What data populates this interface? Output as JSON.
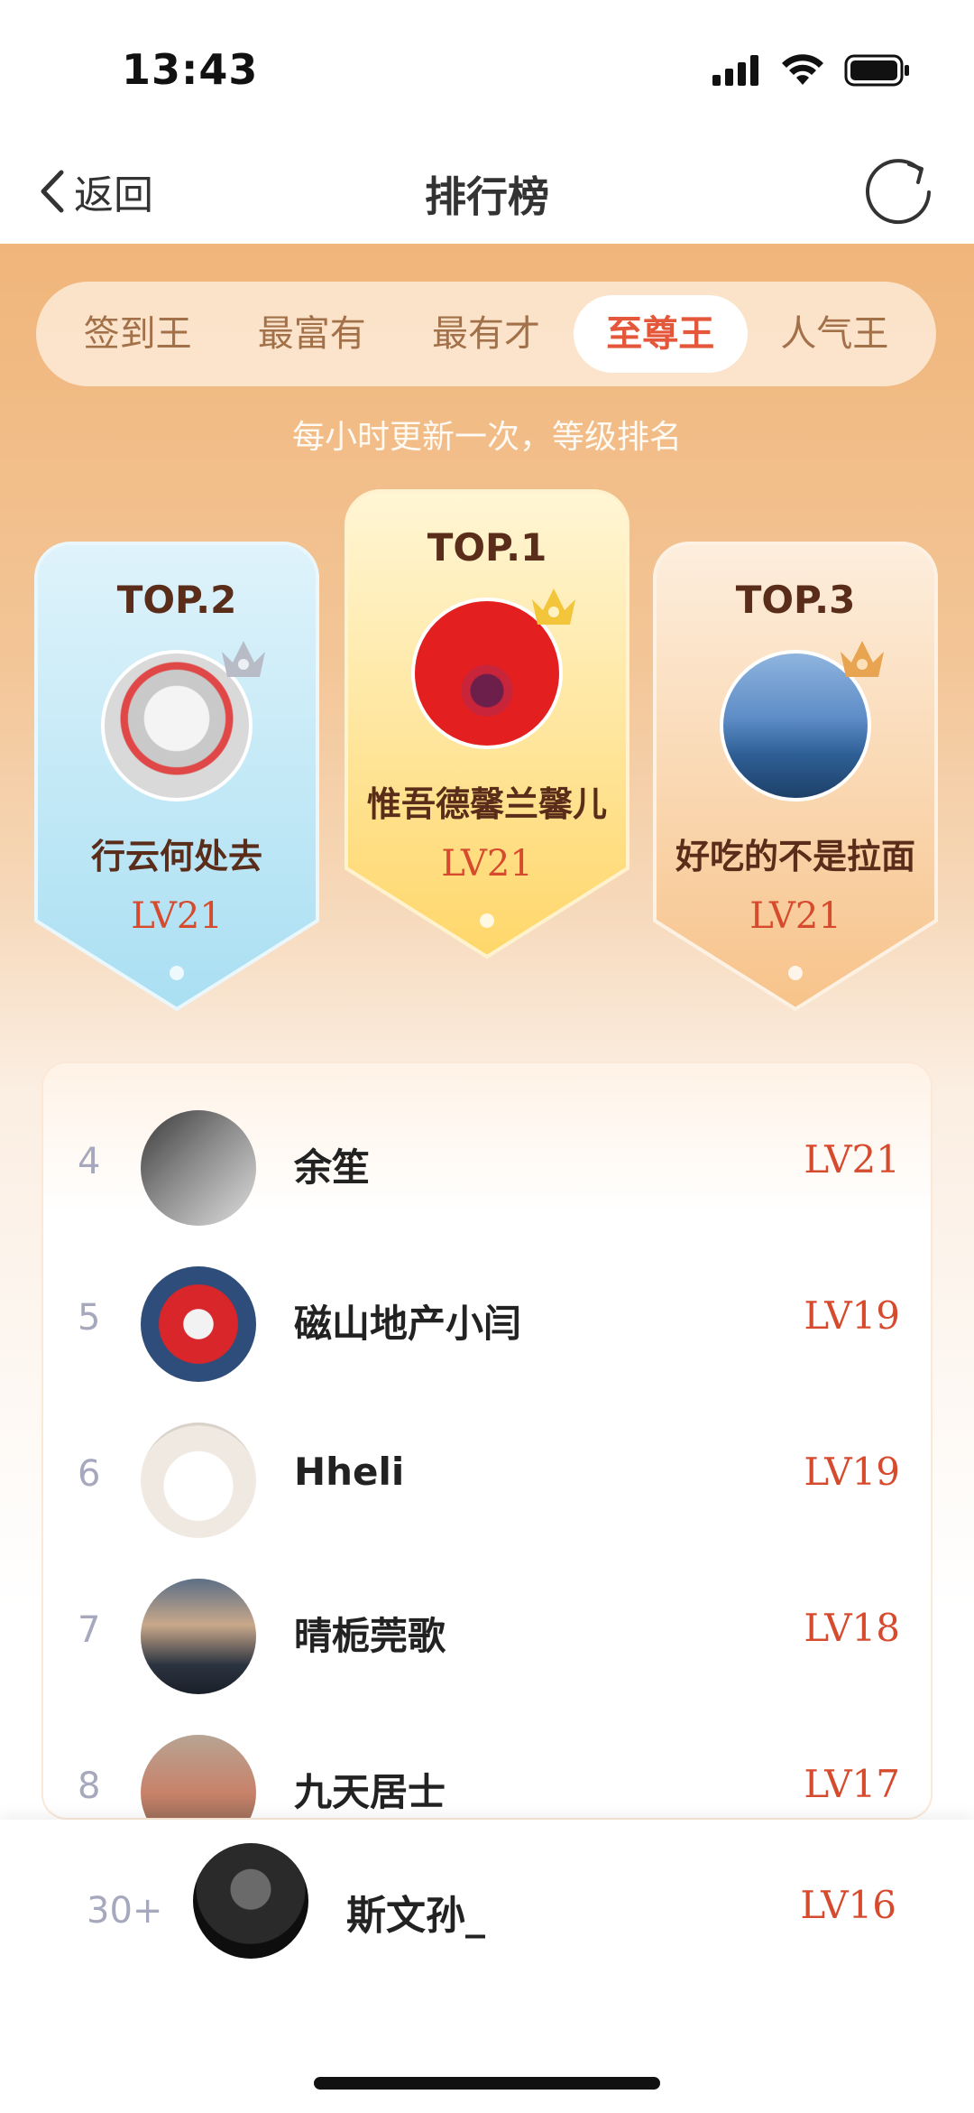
{
  "status": {
    "time": "13:43"
  },
  "nav": {
    "back_label": "返回",
    "title": "排行榜"
  },
  "tabs": [
    {
      "label": "签到王",
      "active": false
    },
    {
      "label": "最富有",
      "active": false
    },
    {
      "label": "最有才",
      "active": false
    },
    {
      "label": "至尊王",
      "active": true
    },
    {
      "label": "人气王",
      "active": false
    }
  ],
  "update_note": "每小时更新一次，等级排名",
  "podium": {
    "first": {
      "rank_label": "TOP.1",
      "name": "惟吾德馨兰馨儿",
      "level": "LV21"
    },
    "second": {
      "rank_label": "TOP.2",
      "name": "行云何处去",
      "level": "LV21"
    },
    "third": {
      "rank_label": "TOP.3",
      "name": "好吃的不是拉面",
      "level": "LV21"
    }
  },
  "list": [
    {
      "rank": "4",
      "name": "余笙",
      "level": "LV21"
    },
    {
      "rank": "5",
      "name": "磁山地产小闫",
      "level": "LV19"
    },
    {
      "rank": "6",
      "name": "Hheli",
      "level": "LV19"
    },
    {
      "rank": "7",
      "name": "晴栀莞歌",
      "level": "LV18"
    },
    {
      "rank": "8",
      "name": "九天居士",
      "level": "LV17"
    }
  ],
  "me": {
    "rank": "30+",
    "name": "斯文孙_",
    "level": "LV16"
  },
  "colors": {
    "accent": "#e5573a",
    "level": "#d64b2e",
    "hero_top": "#f0b57a"
  }
}
